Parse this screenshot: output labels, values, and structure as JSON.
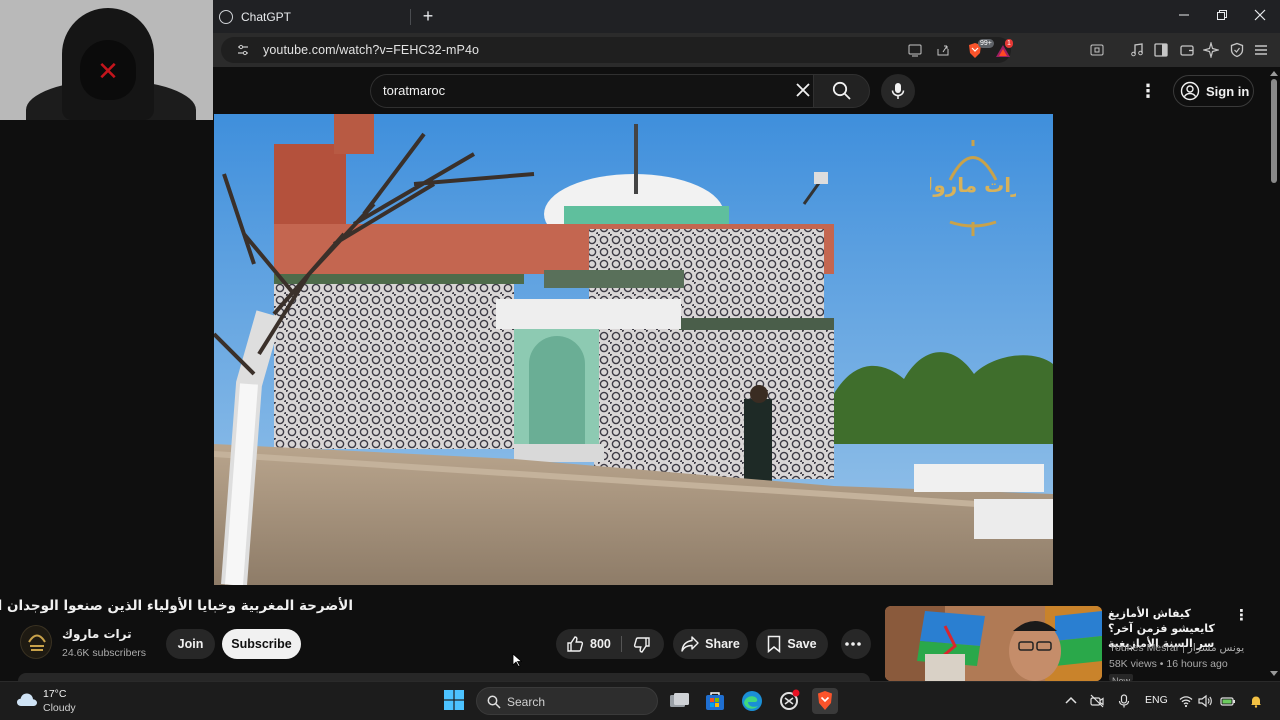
{
  "browser": {
    "tab_title": "ChatGPT",
    "new_tab_symbol": "+",
    "url": "youtube.com/watch?v=FEHC32-mP4o",
    "brave_badge": "99+",
    "rewards_badge": "1",
    "window_controls": [
      "minimize",
      "restore",
      "close"
    ]
  },
  "youtube": {
    "search_query": "toratmaroc",
    "sign_in_label": "Sign in",
    "watermark_text": "ترات ماروك",
    "video": {
      "title": "الأضرحة المغربية وخبايا الأولياء الذين صنعوا الوجدان الشعبي",
      "channel_name": "ترات ماروك",
      "subscribers": "24.6K subscribers",
      "join_label": "Join",
      "subscribe_label": "Subscribe",
      "like_count": "800",
      "share_label": "Share",
      "save_label": "Save"
    },
    "recommended": {
      "title": "كيفاش الأمازيغ كايعيشو فزمن آخر؟ سر السنة الأمازيغية",
      "channel": "Younes Mesrar | يونس مسرار",
      "meta": "58K views • 16 hours ago",
      "badge": "New"
    }
  },
  "taskbar": {
    "temperature": "17°C",
    "condition": "Cloudy",
    "search_label": "Search",
    "language": "ENG"
  },
  "colors": {
    "page_bg": "#0f0f0f",
    "chip_bg": "#272727",
    "subscribe_bg": "#f1f1f1",
    "brave_orange": "#fb542b",
    "sky": "#6aa7de"
  }
}
